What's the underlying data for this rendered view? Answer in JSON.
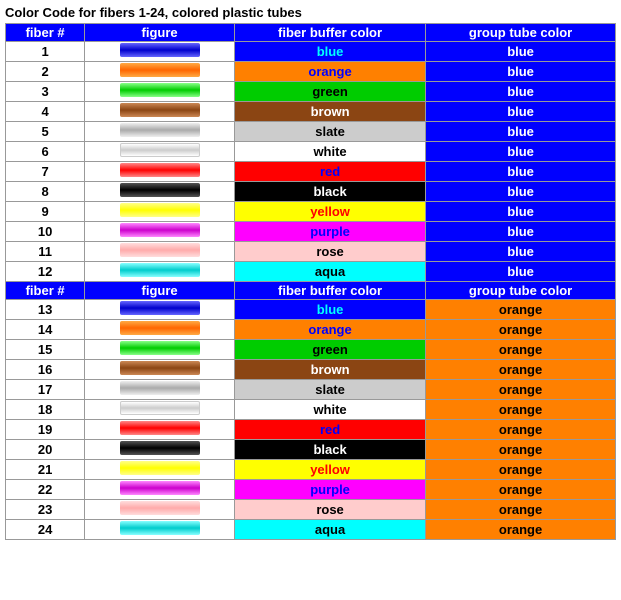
{
  "title": "Color Code for fibers 1-24, colored plastic tubes",
  "headers": {
    "fiber": "fiber #",
    "figure": "figure",
    "fiberBuffer": "fiber buffer color",
    "groupTube": "group tube color"
  },
  "rows": [
    {
      "fiber": "1",
      "figClass": "fig-blue",
      "bufClass": "fiber-buf-blue",
      "bufLabel": "blue",
      "groupClass": "group-tube-blue",
      "groupLabel": "blue"
    },
    {
      "fiber": "2",
      "figClass": "fig-orange",
      "bufClass": "fiber-buf-orange",
      "bufLabel": "orange",
      "groupClass": "group-tube-blue",
      "groupLabel": "blue"
    },
    {
      "fiber": "3",
      "figClass": "fig-green",
      "bufClass": "fiber-buf-green",
      "bufLabel": "green",
      "groupClass": "group-tube-blue",
      "groupLabel": "blue"
    },
    {
      "fiber": "4",
      "figClass": "fig-brown",
      "bufClass": "fiber-buf-brown",
      "bufLabel": "brown",
      "groupClass": "group-tube-blue",
      "groupLabel": "blue"
    },
    {
      "fiber": "5",
      "figClass": "fig-slate",
      "bufClass": "fiber-buf-slate",
      "bufLabel": "slate",
      "groupClass": "group-tube-blue",
      "groupLabel": "blue"
    },
    {
      "fiber": "6",
      "figClass": "fig-white",
      "bufClass": "fiber-buf-white",
      "bufLabel": "white",
      "groupClass": "group-tube-blue",
      "groupLabel": "blue"
    },
    {
      "fiber": "7",
      "figClass": "fig-red",
      "bufClass": "fiber-buf-red",
      "bufLabel": "red",
      "groupClass": "group-tube-blue",
      "groupLabel": "blue"
    },
    {
      "fiber": "8",
      "figClass": "fig-black",
      "bufClass": "fiber-buf-black",
      "bufLabel": "black",
      "groupClass": "group-tube-blue",
      "groupLabel": "blue"
    },
    {
      "fiber": "9",
      "figClass": "fig-yellow",
      "bufClass": "fiber-buf-yellow",
      "bufLabel": "yellow",
      "groupClass": "group-tube-blue",
      "groupLabel": "blue"
    },
    {
      "fiber": "10",
      "figClass": "fig-purple",
      "bufClass": "fiber-buf-purple",
      "bufLabel": "purple",
      "groupClass": "group-tube-blue",
      "groupLabel": "blue"
    },
    {
      "fiber": "11",
      "figClass": "fig-rose",
      "bufClass": "fiber-buf-rose",
      "bufLabel": "rose",
      "groupClass": "group-tube-blue",
      "groupLabel": "blue"
    },
    {
      "fiber": "12",
      "figClass": "fig-aqua",
      "bufClass": "fiber-buf-aqua",
      "bufLabel": "aqua",
      "groupClass": "group-tube-blue",
      "groupLabel": "blue"
    },
    {
      "fiber": "13",
      "figClass": "fig-blue",
      "bufClass": "fiber-buf-blue",
      "bufLabel": "blue",
      "groupClass": "group-tube-orange",
      "groupLabel": "orange"
    },
    {
      "fiber": "14",
      "figClass": "fig-orange",
      "bufClass": "fiber-buf-orange",
      "bufLabel": "orange",
      "groupClass": "group-tube-orange",
      "groupLabel": "orange"
    },
    {
      "fiber": "15",
      "figClass": "fig-green",
      "bufClass": "fiber-buf-green",
      "bufLabel": "green",
      "groupClass": "group-tube-orange",
      "groupLabel": "orange"
    },
    {
      "fiber": "16",
      "figClass": "fig-brown",
      "bufClass": "fiber-buf-brown",
      "bufLabel": "brown",
      "groupClass": "group-tube-orange",
      "groupLabel": "orange"
    },
    {
      "fiber": "17",
      "figClass": "fig-slate",
      "bufClass": "fiber-buf-slate",
      "bufLabel": "slate",
      "groupClass": "group-tube-orange",
      "groupLabel": "orange"
    },
    {
      "fiber": "18",
      "figClass": "fig-white",
      "bufClass": "fiber-buf-white",
      "bufLabel": "white",
      "groupClass": "group-tube-orange",
      "groupLabel": "orange"
    },
    {
      "fiber": "19",
      "figClass": "fig-red",
      "bufClass": "fiber-buf-red",
      "bufLabel": "red",
      "groupClass": "group-tube-orange",
      "groupLabel": "orange"
    },
    {
      "fiber": "20",
      "figClass": "fig-black",
      "bufClass": "fiber-buf-black",
      "bufLabel": "black",
      "groupClass": "group-tube-orange",
      "groupLabel": "orange"
    },
    {
      "fiber": "21",
      "figClass": "fig-yellow",
      "bufClass": "fiber-buf-yellow",
      "bufLabel": "yellow",
      "groupClass": "group-tube-orange",
      "groupLabel": "orange"
    },
    {
      "fiber": "22",
      "figClass": "fig-purple",
      "bufClass": "fiber-buf-purple",
      "bufLabel": "purple",
      "groupClass": "group-tube-orange",
      "groupLabel": "orange"
    },
    {
      "fiber": "23",
      "figClass": "fig-rose",
      "bufClass": "fiber-buf-rose",
      "bufLabel": "rose",
      "groupClass": "group-tube-orange",
      "groupLabel": "orange"
    },
    {
      "fiber": "24",
      "figClass": "fig-aqua",
      "bufClass": "fiber-buf-aqua",
      "bufLabel": "aqua",
      "groupClass": "group-tube-orange",
      "groupLabel": "orange"
    }
  ]
}
